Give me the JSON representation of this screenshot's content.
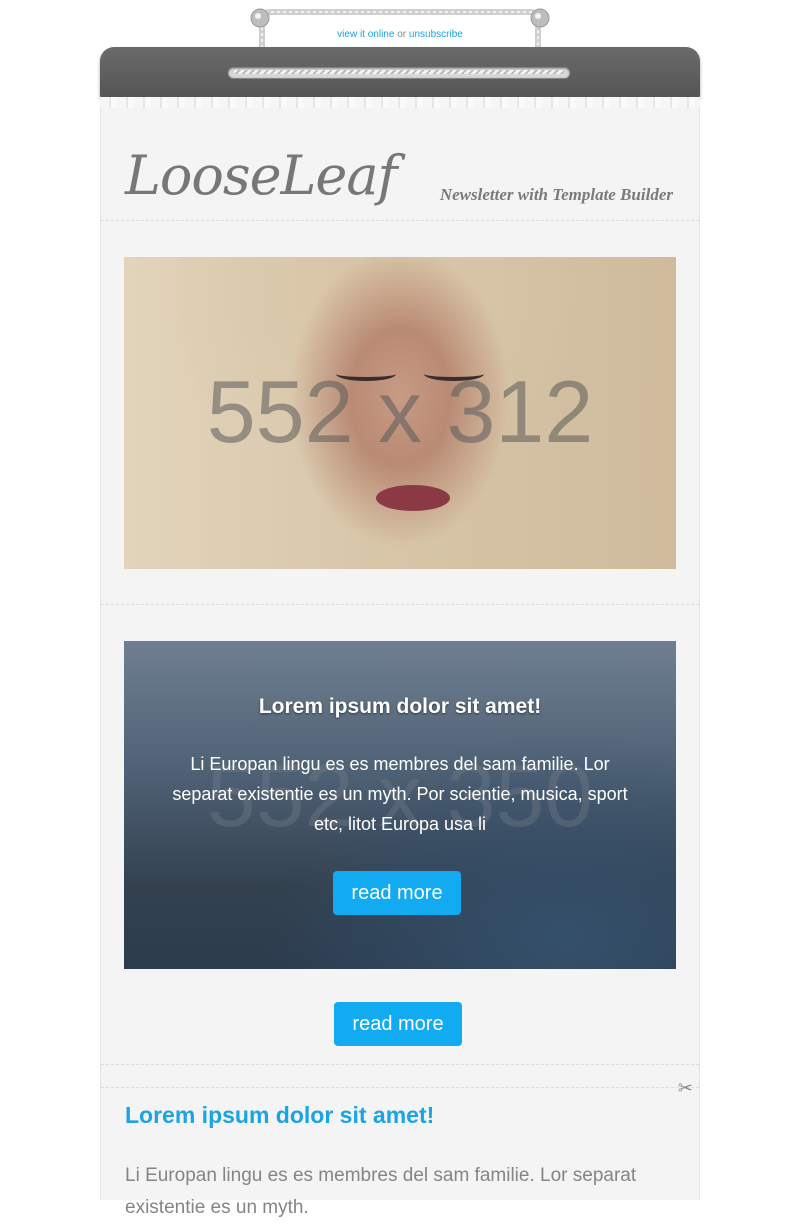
{
  "preheader": {
    "view_online": "view it online",
    "separator": "or",
    "unsubscribe": "unsubscribe"
  },
  "header": {
    "logo": "LooseLeaf",
    "tagline": "Newsletter with Template Builder"
  },
  "hero": {
    "placeholder": "552 x 312"
  },
  "banner": {
    "placeholder": "552 x 350",
    "title": "Lorem ipsum dolor sit amet!",
    "body": "Li Europan lingu es es membres del sam familie. Lor separat existentie es un myth. Por scientie, musica, sport etc, litot Europa usa li",
    "button": "read more"
  },
  "cta": {
    "button": "read more"
  },
  "article": {
    "title": "Lorem ipsum dolor sit amet!",
    "body": "Li Europan lingu es es membres del sam familie. Lor separat existentie es un myth."
  },
  "icons": {
    "scissors": "scissors-icon"
  },
  "colors": {
    "accent": "#12aaf0",
    "link": "#1aa3df",
    "clip": "#5e5e5e",
    "paper": "#f4f4f4"
  }
}
